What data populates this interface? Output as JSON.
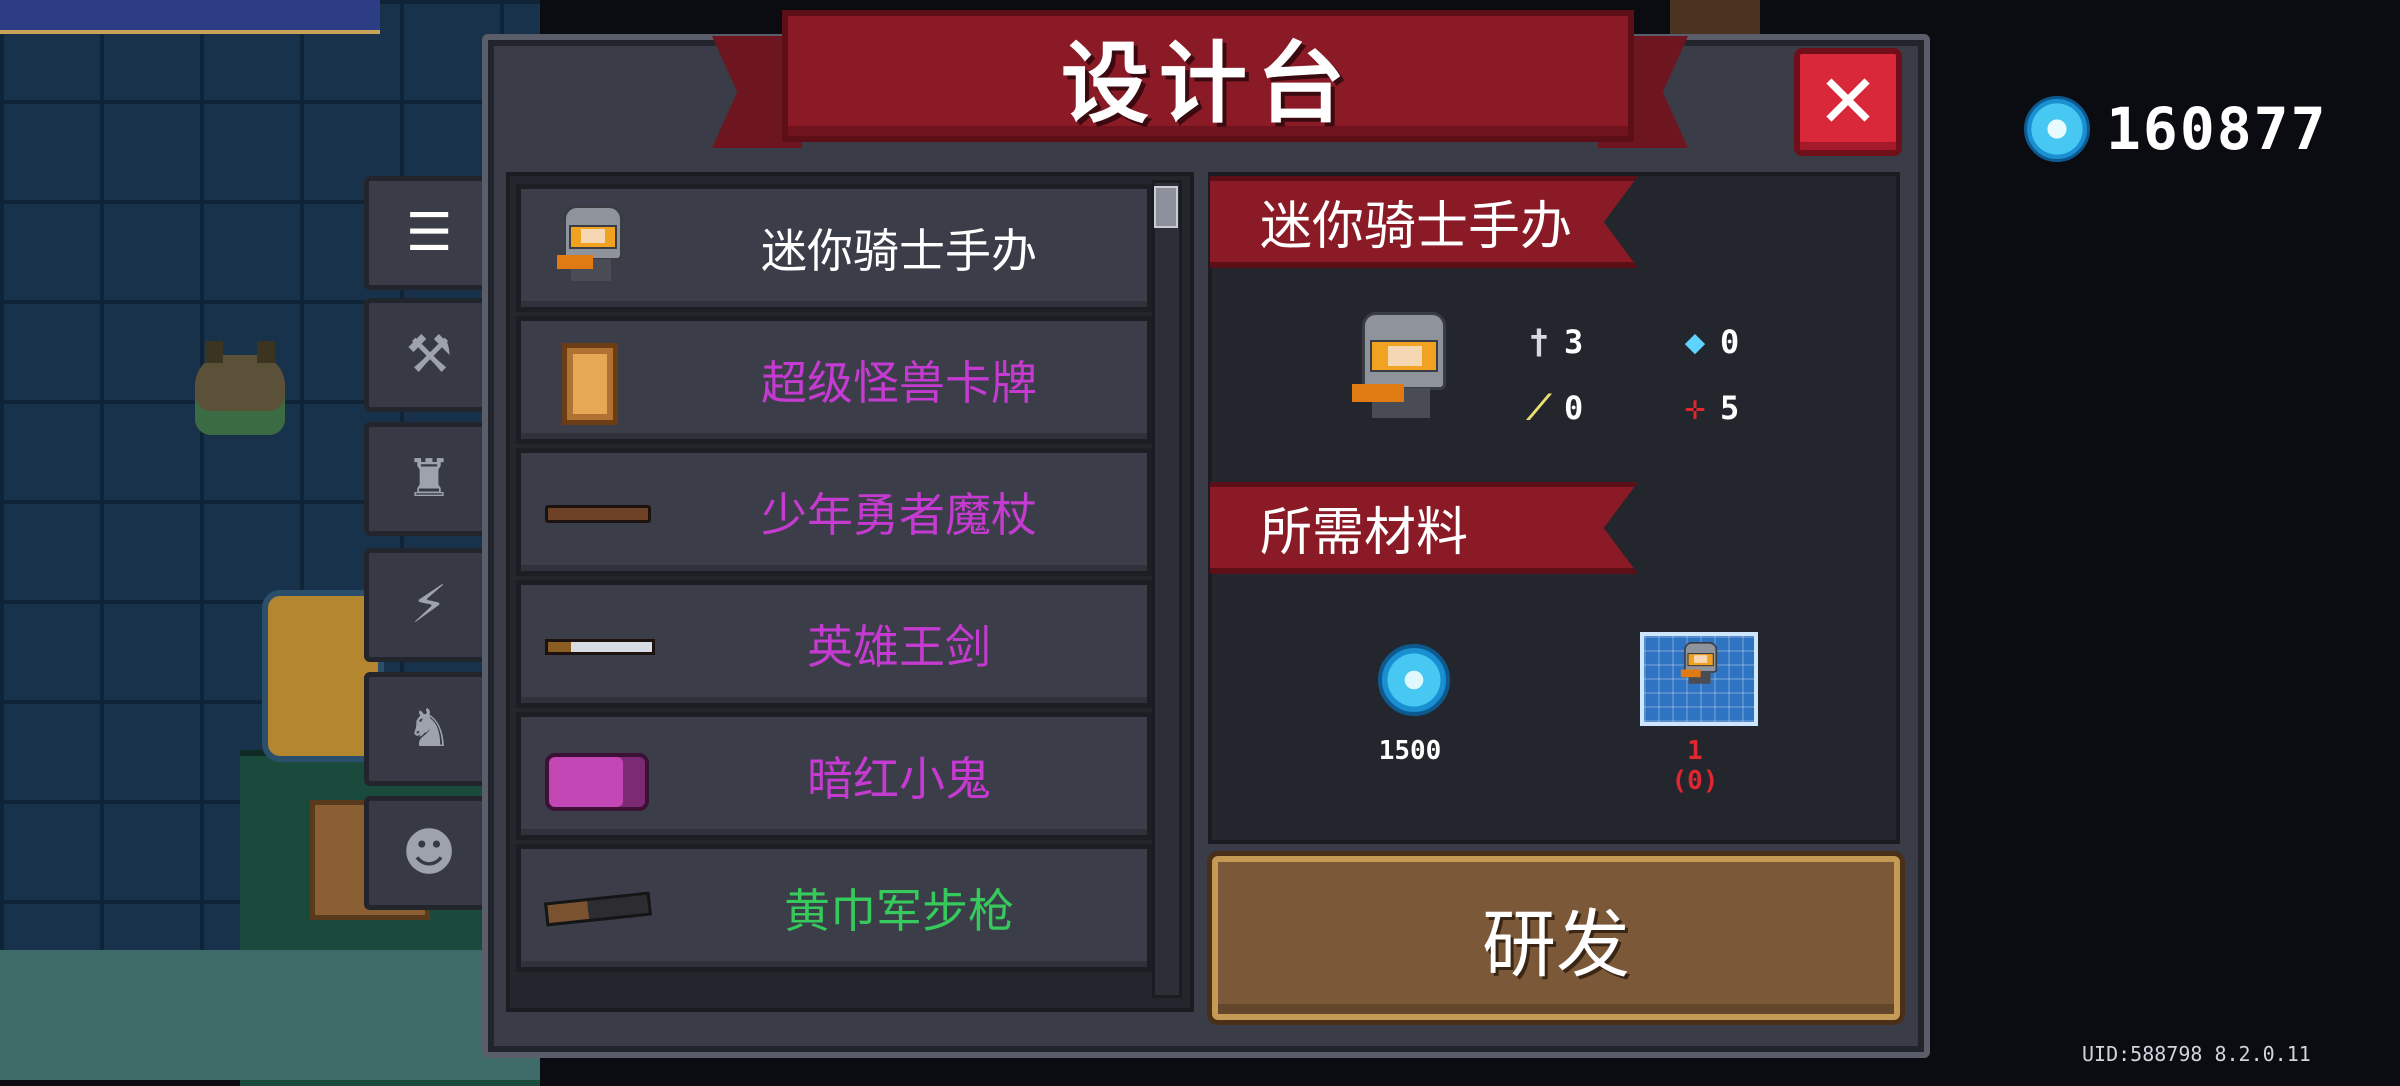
{
  "title": "设计台",
  "currency": {
    "icon": "blue-gem-icon",
    "value": "160877"
  },
  "uid": "UID:588798 8.2.0.11",
  "tabs": [
    {
      "icon": "list-icon",
      "active": true
    },
    {
      "icon": "gun-icon",
      "active": false
    },
    {
      "icon": "armor-icon",
      "active": false
    },
    {
      "icon": "lightning-icon",
      "active": false
    },
    {
      "icon": "pets-icon",
      "active": false
    },
    {
      "icon": "character-icon",
      "active": false
    }
  ],
  "items": [
    {
      "name": "迷你骑士手办",
      "color": "#ffffff",
      "icon": "mini-knight-figure-icon"
    },
    {
      "name": "超级怪兽卡牌",
      "color": "#c53ad0",
      "icon": "monster-card-icon"
    },
    {
      "name": "少年勇者魔杖",
      "color": "#c53ad0",
      "icon": "wand-icon"
    },
    {
      "name": "英雄王剑",
      "color": "#c53ad0",
      "icon": "sword-icon"
    },
    {
      "name": "暗红小鬼",
      "color": "#c53ad0",
      "icon": "camera-icon"
    },
    {
      "name": "黄巾军步枪",
      "color": "#36c95b",
      "icon": "rifle-icon"
    }
  ],
  "detail": {
    "name": "迷你骑士手办",
    "stats": [
      {
        "icon": "sword-stat-icon",
        "value": "3"
      },
      {
        "icon": "energy-gem-stat-icon",
        "value": "0"
      },
      {
        "icon": "crit-stat-icon",
        "value": "0"
      },
      {
        "icon": "accuracy-stat-icon",
        "value": "5"
      }
    ],
    "materials_title": "所需材料",
    "materials": [
      {
        "icon": "blue-gem-icon",
        "amount": "1500",
        "color": "#ffffff"
      },
      {
        "icon": "blueprint-icon",
        "amount": "1",
        "owned": "(0)",
        "color": "#e0262e"
      }
    ],
    "button": "研发"
  }
}
